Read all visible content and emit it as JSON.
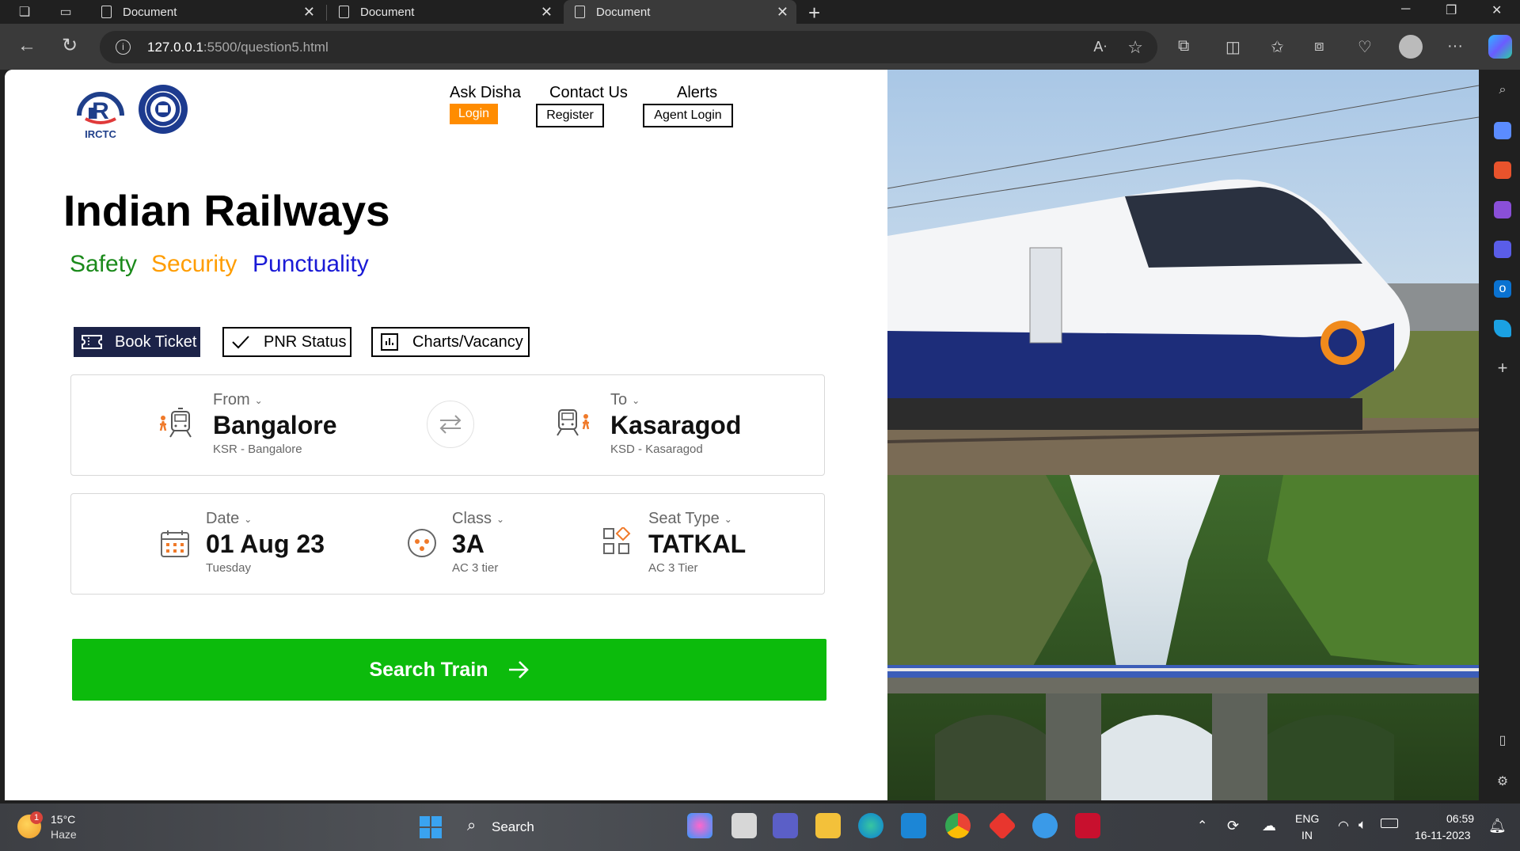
{
  "browser": {
    "tabs": [
      {
        "title": "Document"
      },
      {
        "title": "Document"
      },
      {
        "title": "Document"
      }
    ],
    "url_host": "127.0.0.1",
    "url_rest": ":5500/question5.html"
  },
  "header": {
    "nav": {
      "ask_disha": "Ask Disha",
      "contact_us": "Contact Us",
      "alerts": "Alerts"
    },
    "buttons": {
      "login": "Login",
      "register": "Register",
      "agent_login": "Agent Login"
    },
    "logo_text": "IRCTC"
  },
  "hero": {
    "title": "Indian Railways",
    "tags": [
      {
        "text": "Safety",
        "color": "#1b8a1b"
      },
      {
        "text": "Security",
        "color": "#ff9d00"
      },
      {
        "text": "Punctuality",
        "color": "#1a1ad6"
      }
    ]
  },
  "service_tabs": [
    {
      "label": "Book Ticket",
      "icon": "ticket-icon",
      "active": true
    },
    {
      "label": "PNR Status",
      "icon": "check-icon",
      "active": false
    },
    {
      "label": "Charts/Vacancy",
      "icon": "chart-icon",
      "active": false
    }
  ],
  "journey": {
    "from": {
      "label": "From",
      "value": "Bangalore",
      "sub": "KSR - Bangalore"
    },
    "to": {
      "label": "To",
      "value": "Kasaragod",
      "sub": "KSD - Kasaragod"
    }
  },
  "options": {
    "date": {
      "label": "Date",
      "value": "01 Aug 23",
      "sub": "Tuesday"
    },
    "class": {
      "label": "Class",
      "value": "3A",
      "sub": "AC 3 tier"
    },
    "seat_type": {
      "label": "Seat Type",
      "value": "TATKAL",
      "sub": "AC 3 Tier"
    }
  },
  "search_button": "Search Train",
  "taskbar": {
    "weather_temp": "15°C",
    "weather_desc": "Haze",
    "weather_badge": "1",
    "search_label": "Search",
    "lang_top": "ENG",
    "lang_bottom": "IN",
    "time": "06:59",
    "date": "16-11-2023"
  },
  "colors": {
    "accent_green": "#0cbb0c",
    "login_orange": "#ff8c00",
    "book_tab_navy": "#1c2348"
  }
}
